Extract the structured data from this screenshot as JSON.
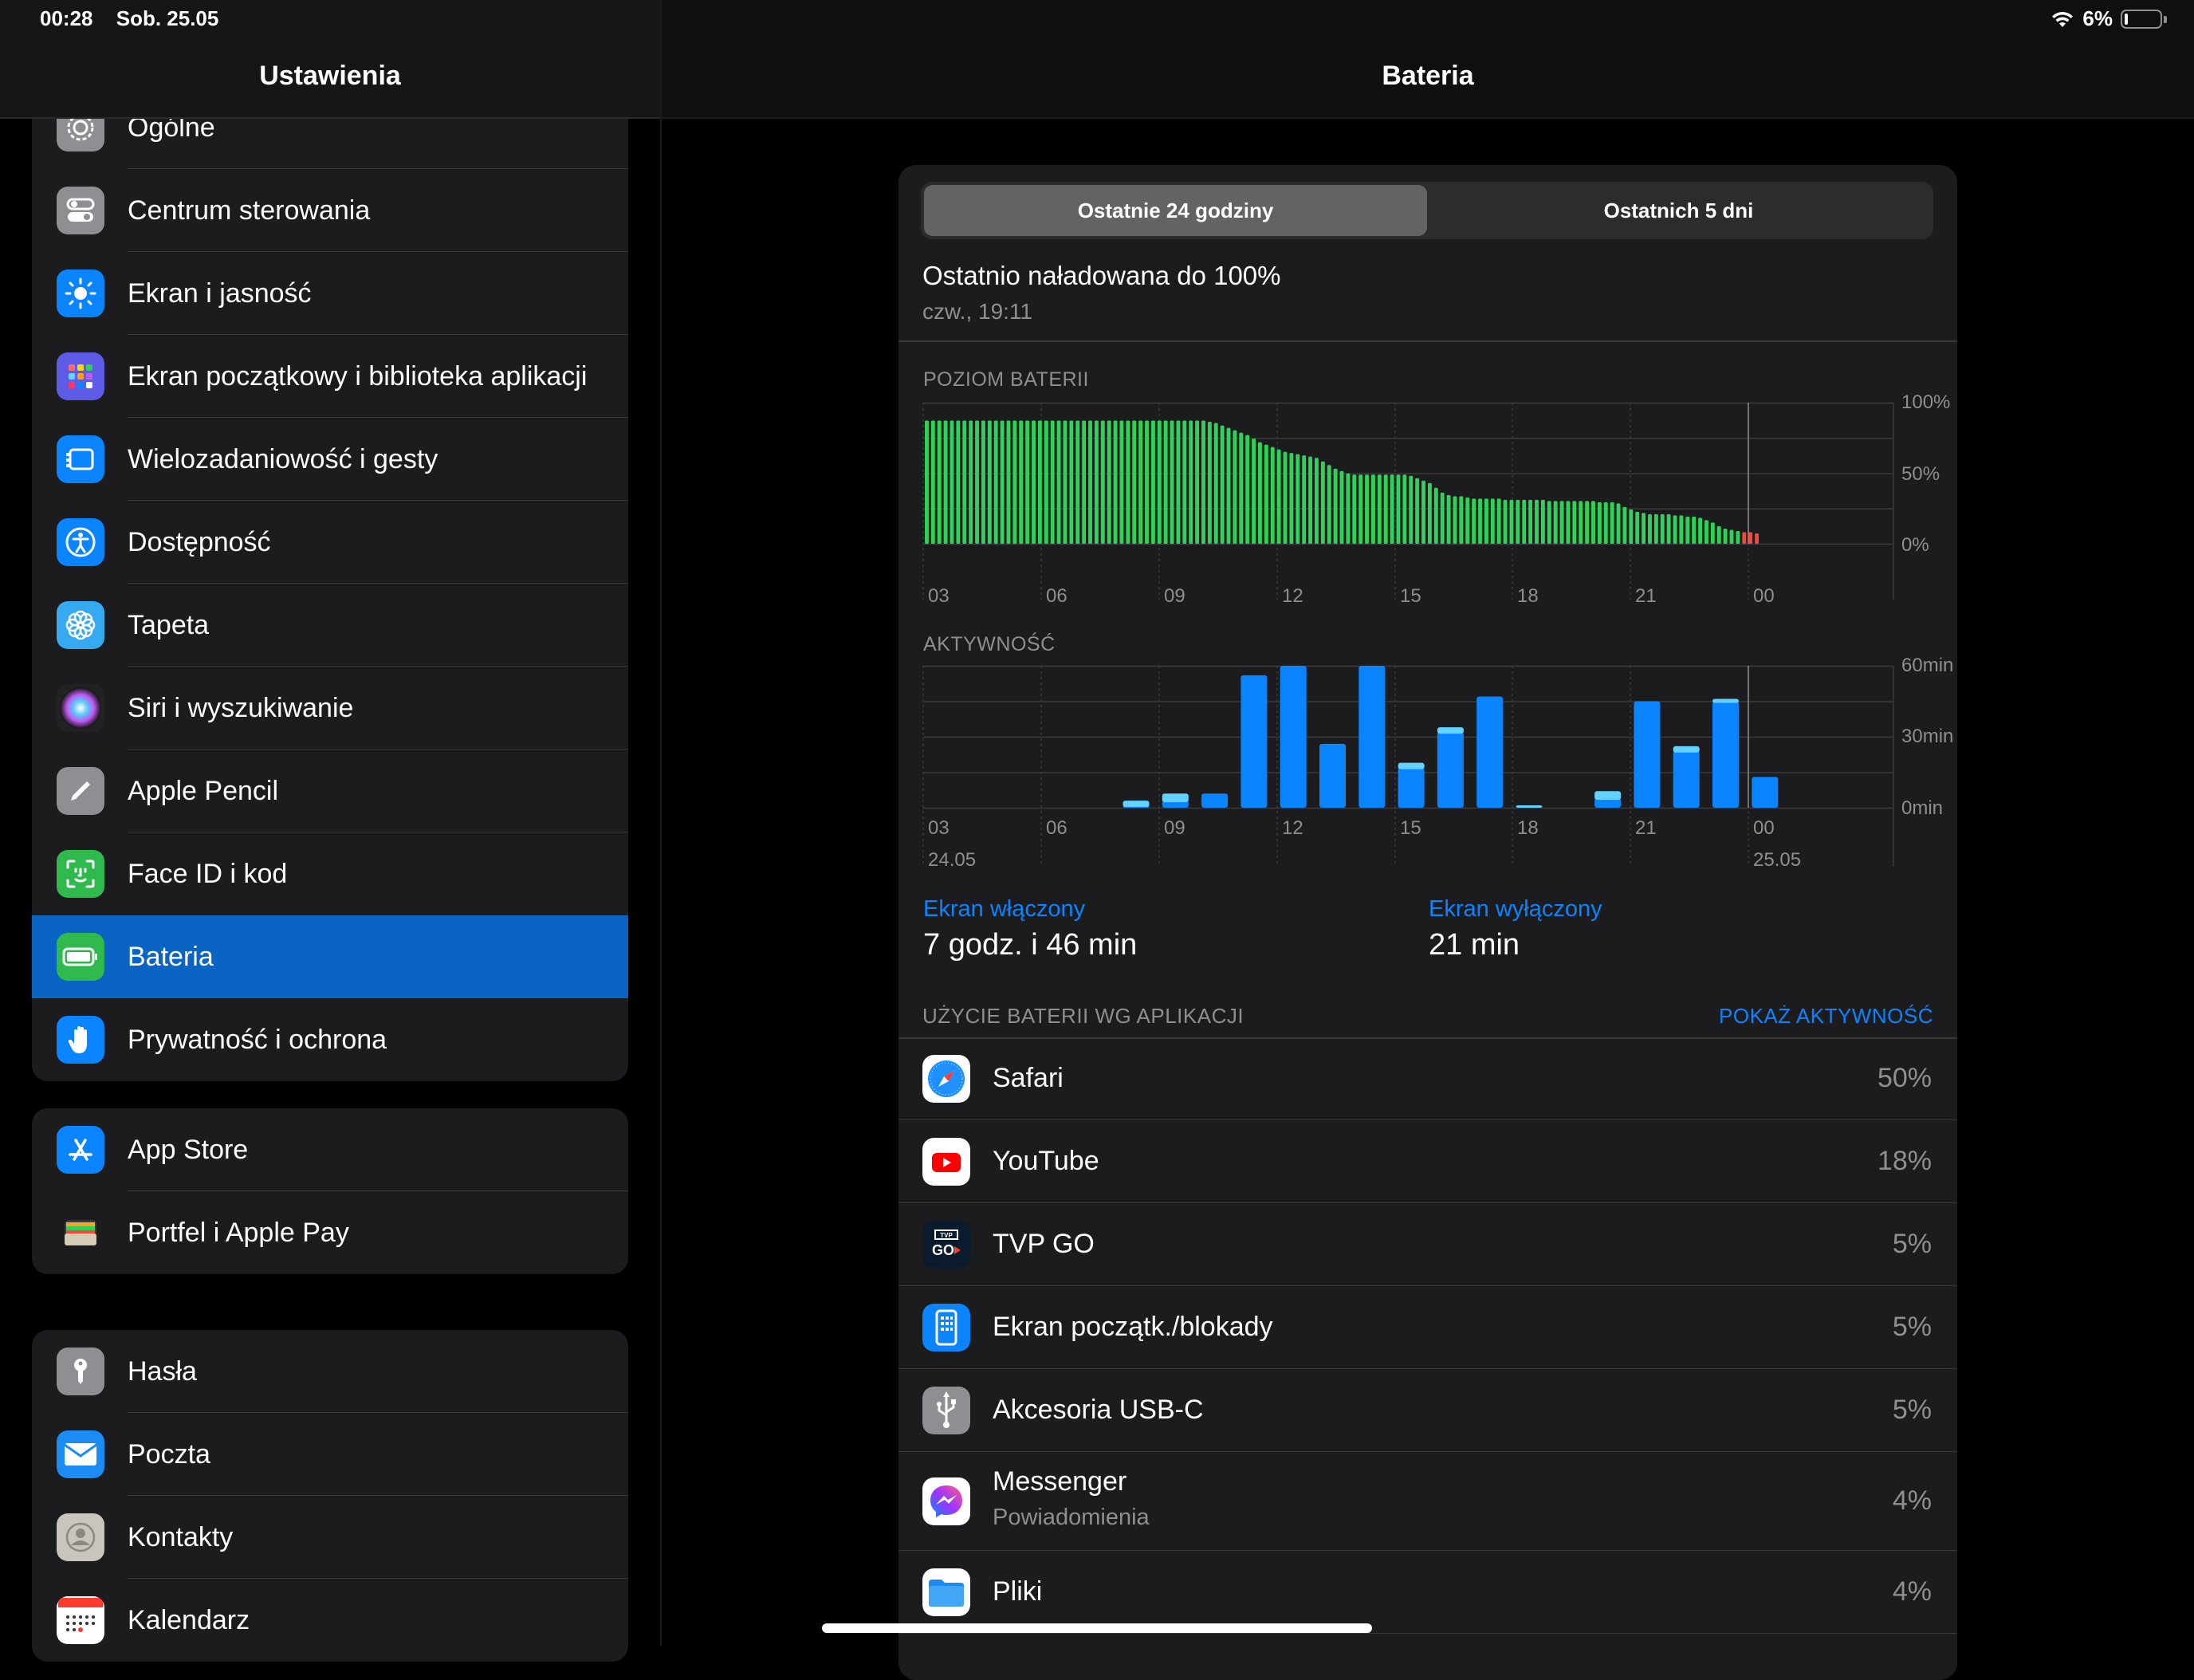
{
  "status_bar": {
    "time": "00:28",
    "date": "Sob. 25.05",
    "battery_pct": "6%",
    "battery_level": 0.06
  },
  "sidebar": {
    "title": "Ustawienia",
    "groups": [
      {
        "items": [
          {
            "label": "Ogólne",
            "icon": "gear-icon",
            "color": "#8e8e93"
          },
          {
            "label": "Centrum sterowania",
            "icon": "switches-icon",
            "color": "#8e8e93"
          },
          {
            "label": "Ekran i jasność",
            "icon": "sun-icon",
            "color": "#0a84ff"
          },
          {
            "label": "Ekran początkowy i biblioteka aplikacji",
            "icon": "app-grid-icon",
            "color": "#5e5ce6"
          },
          {
            "label": "Wielozadaniowość i gesty",
            "icon": "multitask-icon",
            "color": "#0a84ff"
          },
          {
            "label": "Dostępność",
            "icon": "accessibility-icon",
            "color": "#0a84ff"
          },
          {
            "label": "Tapeta",
            "icon": "flower-icon",
            "color": "#35aaf0"
          },
          {
            "label": "Siri i wyszukiwanie",
            "icon": "siri-icon",
            "color": "#222"
          },
          {
            "label": "Apple Pencil",
            "icon": "pencil-icon",
            "color": "#8e8e93"
          },
          {
            "label": "Face ID i kod",
            "icon": "faceid-icon",
            "color": "#30b94d"
          },
          {
            "label": "Bateria",
            "icon": "battery-icon",
            "color": "#30b94d",
            "selected": true
          },
          {
            "label": "Prywatność i ochrona",
            "icon": "hand-icon",
            "color": "#0a84ff"
          }
        ]
      },
      {
        "items": [
          {
            "label": "App Store",
            "icon": "appstore-icon",
            "color": "#0a84ff"
          },
          {
            "label": "Portfel i Apple Pay",
            "icon": "wallet-icon",
            "color": "#1c1c1e"
          }
        ]
      },
      {
        "items": [
          {
            "label": "Hasła",
            "icon": "key-icon",
            "color": "#8e8e93"
          },
          {
            "label": "Poczta",
            "icon": "mail-icon",
            "color": "#1b8cf5"
          },
          {
            "label": "Kontakty",
            "icon": "contacts-icon",
            "color": "#c9c5bd"
          },
          {
            "label": "Kalendarz",
            "icon": "calendar-icon",
            "color": "#ffffff"
          }
        ]
      }
    ]
  },
  "main": {
    "title": "Bateria",
    "segments": [
      "Ostatnie 24 godziny",
      "Ostatnich 5 dni"
    ],
    "last_charged": "Ostatnio naładowana do 100%",
    "last_charged_time": "czw., 19:11",
    "battery_section": "POZIOM BATERII",
    "activity_section": "AKTYWNOŚĆ",
    "screen_on_label": "Ekran włączony",
    "screen_on_value": "7 godz. i 46 min",
    "screen_off_label": "Ekran wyłączony",
    "screen_off_value": "21 min",
    "apps_header": "UŻYCIE BATERII WG APLIKACJI",
    "show_activity": "POKAŻ AKTYWNOŚĆ",
    "apps": [
      {
        "name": "Safari",
        "pct": "50%",
        "icon": "safari-icon"
      },
      {
        "name": "YouTube",
        "pct": "18%",
        "icon": "youtube-icon"
      },
      {
        "name": "TVP GO",
        "pct": "5%",
        "icon": "tvpgo-icon"
      },
      {
        "name": "Ekran początk./blokady",
        "pct": "5%",
        "icon": "home-lock-screen-icon"
      },
      {
        "name": "Akcesoria USB-C",
        "pct": "5%",
        "icon": "usb-icon"
      },
      {
        "name": "Messenger",
        "sub": "Powiadomienia",
        "pct": "4%",
        "icon": "messenger-icon"
      },
      {
        "name": "Pliki",
        "pct": "4%",
        "icon": "files-icon"
      }
    ]
  },
  "chart_data": [
    {
      "type": "bar",
      "title": "POZIOM BATERII",
      "x_tick_labels": [
        "03",
        "06",
        "09",
        "12",
        "15",
        "18",
        "21",
        "00"
      ],
      "y_tick_labels": [
        "100%",
        "50%",
        "0%"
      ],
      "ylim": [
        0,
        100
      ],
      "colors": {
        "normal": "#30d158",
        "low": "#ff453a"
      },
      "values": [
        100,
        100,
        100,
        100,
        100,
        100,
        100,
        100,
        100,
        100,
        100,
        100,
        100,
        100,
        100,
        100,
        100,
        100,
        100,
        100,
        100,
        100,
        100,
        100,
        100,
        100,
        100,
        100,
        100,
        100,
        100,
        100,
        100,
        100,
        100,
        100,
        100,
        100,
        100,
        100,
        100,
        100,
        100,
        100,
        100,
        99,
        98,
        96,
        94,
        92,
        90,
        88,
        85,
        82,
        80,
        78,
        76,
        74,
        73,
        72,
        71,
        70,
        69,
        66,
        63,
        60,
        58,
        56,
        55,
        55,
        55,
        55,
        55,
        55,
        55,
        55,
        55,
        54,
        52,
        50,
        48,
        44,
        40,
        38,
        37,
        37,
        36,
        35,
        35,
        35,
        35,
        35,
        34,
        34,
        34,
        34,
        34,
        34,
        34,
        33,
        33,
        33,
        33,
        33,
        33,
        33,
        33,
        32,
        32,
        32,
        31,
        28,
        26,
        24,
        23,
        22,
        22,
        22,
        22,
        21,
        21,
        20,
        20,
        19,
        17,
        15,
        12,
        10,
        9,
        8,
        7,
        7,
        6
      ],
      "low_from_index": 130
    },
    {
      "type": "bar",
      "title": "AKTYWNOŚĆ",
      "x_tick_labels": [
        "03",
        "06",
        "09",
        "12",
        "15",
        "18",
        "21",
        "00"
      ],
      "date_labels": [
        "24.05",
        "25.05"
      ],
      "y_tick_labels": [
        "60min",
        "30min",
        "0min"
      ],
      "ylim": [
        0,
        60
      ],
      "units": "min",
      "categories": [
        "03",
        "04",
        "05",
        "06",
        "07",
        "08",
        "09",
        "10",
        "11",
        "12",
        "13",
        "14",
        "15",
        "16",
        "17",
        "18",
        "19",
        "20",
        "21",
        "22",
        "23",
        "00",
        "01"
      ],
      "series": [
        {
          "name": "Ekran włączony",
          "color": "#0a84ff",
          "values": [
            0,
            0,
            0,
            0,
            0,
            1,
            3,
            6,
            56,
            60,
            27,
            60,
            17,
            32,
            47,
            0,
            0,
            4,
            45,
            24,
            45,
            13,
            0
          ]
        },
        {
          "name": "Ekran wyłączony",
          "color": "#64d2ff",
          "values": [
            0,
            0,
            0,
            0,
            0,
            2,
            3,
            0,
            0,
            0,
            0,
            0,
            2,
            2,
            0,
            1,
            0,
            3,
            0,
            2,
            1,
            0,
            0
          ]
        }
      ]
    }
  ]
}
